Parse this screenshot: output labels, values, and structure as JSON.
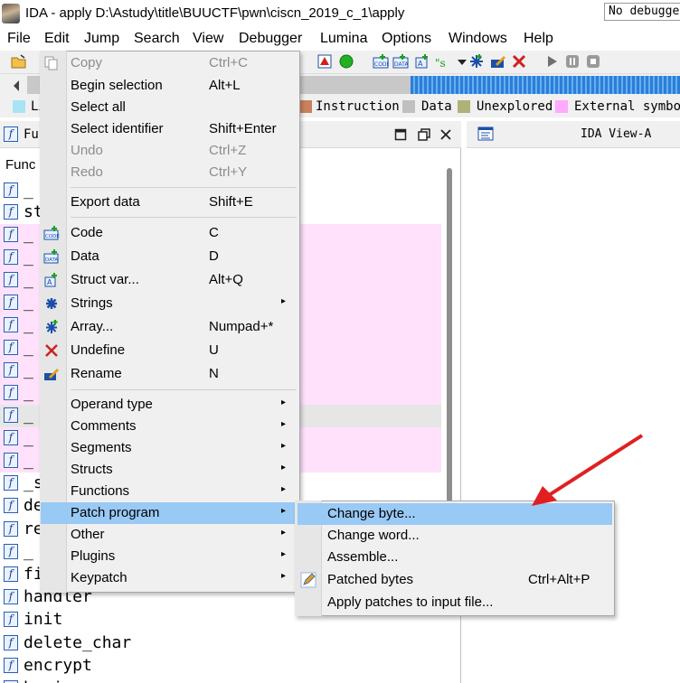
{
  "window": {
    "title": "IDA - apply D:\\Astudy\\title\\BUUCTF\\pwn\\ciscn_2019_c_1\\apply"
  },
  "menubar": [
    "File",
    "Edit",
    "Jump",
    "Search",
    "View",
    "Debugger",
    "Lumina",
    "Options",
    "Windows",
    "Help"
  ],
  "toolbar": {
    "debugger_select": "No debugger",
    "icons": [
      "open-icon",
      "stop-icon",
      "run-icon",
      "code-icon",
      "data-icon",
      "struct-icon",
      "strings-icon",
      "array-icon",
      "rename-icon",
      "undefine-icon",
      "play-icon",
      "pause-icon",
      "stop-debug-icon"
    ]
  },
  "legend": [
    {
      "label": "Library function",
      "color": "#a8e4f4"
    },
    {
      "label": "Instruction",
      "color": "#c8815c"
    },
    {
      "label": "Data",
      "color": "#c0c0c0"
    },
    {
      "label": "Unexplored",
      "color": "#b0b07a"
    },
    {
      "label": "External symbol",
      "color": "#ffaaff"
    }
  ],
  "left_pane": {
    "title": "Fu",
    "column_header": "Func",
    "functions": [
      "_",
      "st",
      "_",
      "_",
      "_",
      "_",
      "_",
      "_",
      "_",
      "_",
      "_",
      "_",
      "_",
      "_s",
      "de",
      "re",
      "_",
      "fi",
      "handler",
      "init",
      "delete_char",
      "encrypt",
      "begin"
    ]
  },
  "right_pane": {
    "title": "IDA View-A"
  },
  "context_menu": {
    "items": [
      {
        "label": "Copy",
        "shortcut": "Ctrl+C",
        "disabled": true,
        "icon": "copy-icon"
      },
      {
        "label": "Begin selection",
        "shortcut": "Alt+L"
      },
      {
        "label": "Select all",
        "shortcut": ""
      },
      {
        "label": "Select identifier",
        "shortcut": "Shift+Enter"
      },
      {
        "label": "Undo",
        "shortcut": "Ctrl+Z",
        "disabled": true
      },
      {
        "label": "Redo",
        "shortcut": "Ctrl+Y",
        "disabled": true
      },
      {
        "label": "Export data",
        "shortcut": "Shift+E"
      },
      {
        "label": "Code",
        "shortcut": "C",
        "icon": "code-icon"
      },
      {
        "label": "Data",
        "shortcut": "D",
        "icon": "data-icon"
      },
      {
        "label": "Struct var...",
        "shortcut": "Alt+Q",
        "icon": "struct-icon"
      },
      {
        "label": "Strings",
        "shortcut": "",
        "submenu": true,
        "icon": "strings-icon"
      },
      {
        "label": "Array...",
        "shortcut": "Numpad+*",
        "icon": "array-icon"
      },
      {
        "label": "Undefine",
        "shortcut": "U",
        "icon": "undefine-icon"
      },
      {
        "label": "Rename",
        "shortcut": "N",
        "icon": "rename-icon"
      },
      {
        "label": "Operand type",
        "shortcut": "",
        "submenu": true
      },
      {
        "label": "Comments",
        "shortcut": "",
        "submenu": true
      },
      {
        "label": "Segments",
        "shortcut": "",
        "submenu": true
      },
      {
        "label": "Structs",
        "shortcut": "",
        "submenu": true
      },
      {
        "label": "Functions",
        "shortcut": "",
        "submenu": true
      },
      {
        "label": "Patch program",
        "shortcut": "",
        "submenu": true,
        "highlighted": true
      },
      {
        "label": "Other",
        "shortcut": "",
        "submenu": true
      },
      {
        "label": "Plugins",
        "shortcut": "",
        "submenu": true
      },
      {
        "label": "Keypatch",
        "shortcut": "",
        "submenu": true
      }
    ]
  },
  "patch_submenu": {
    "items": [
      {
        "label": "Change byte...",
        "shortcut": "",
        "highlighted": true
      },
      {
        "label": "Change word...",
        "shortcut": ""
      },
      {
        "label": "Assemble...",
        "shortcut": ""
      },
      {
        "label": "Patched bytes",
        "shortcut": "Ctrl+Alt+P",
        "icon": "pencil-icon"
      },
      {
        "label": "Apply patches to input file...",
        "shortcut": ""
      }
    ]
  },
  "annotation": {
    "color": "#e02020"
  }
}
